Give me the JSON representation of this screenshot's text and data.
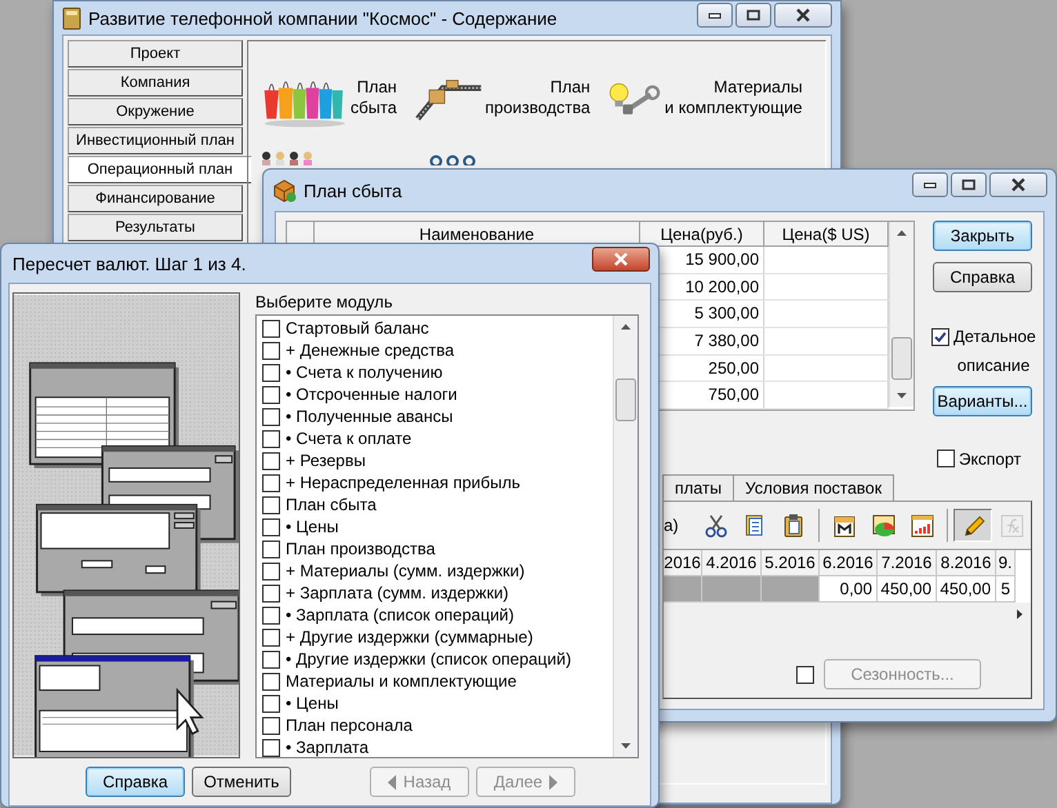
{
  "main_window": {
    "title": "Развитие телефонной компании \"Космос\" - Содержание",
    "nav": [
      {
        "label": "Проект",
        "selected": false
      },
      {
        "label": "Компания",
        "selected": false
      },
      {
        "label": "Окружение",
        "selected": false
      },
      {
        "label": "Инвестиционный план",
        "selected": false
      },
      {
        "label": "Операционный план",
        "selected": true
      },
      {
        "label": "Финансирование",
        "selected": false
      },
      {
        "label": "Результаты",
        "selected": false
      }
    ],
    "modules": [
      {
        "kind": "bags",
        "lines": [
          "План",
          "сбыта"
        ]
      },
      {
        "kind": "conveyor",
        "lines": [
          "План",
          "производства"
        ]
      },
      {
        "kind": "bulb",
        "lines": [
          "Материалы",
          "и комплектующие"
        ]
      },
      {
        "kind": "people"
      },
      {
        "kind": "gears"
      }
    ]
  },
  "sales_window": {
    "title": "План сбыта",
    "table": {
      "columns": [
        "Наименование",
        "Цена(руб.)",
        "Цена($ US)"
      ],
      "rows": [
        {
          "price_rub": "15 900,00"
        },
        {
          "price_rub": "10 200,00"
        },
        {
          "price_rub": "5 300,00"
        },
        {
          "price_rub": "7 380,00"
        },
        {
          "price_rub": "250,00"
        },
        {
          "price_rub": "750,00"
        }
      ]
    },
    "buttons": [
      {
        "label": "Закрыть",
        "highlighted": true
      },
      {
        "label": "Справка",
        "highlighted": false
      }
    ],
    "detailed": {
      "label": "Детальное описание",
      "checked": true
    },
    "variants_button": {
      "label": "Варианты...",
      "highlighted": true
    },
    "export": {
      "label": "Экспорт",
      "checked": false
    },
    "tabs": [
      {
        "label": "платы",
        "selected": false
      },
      {
        "label": "Условия поставок",
        "selected": false
      }
    ],
    "toolbar_caption": "а)",
    "toolbar": [
      {
        "kind": "cut",
        "pressed": false,
        "disabled": false
      },
      {
        "kind": "copy",
        "pressed": false,
        "disabled": false
      },
      {
        "kind": "paste",
        "pressed": false,
        "disabled": false
      },
      {
        "kind": "separator"
      },
      {
        "kind": "calendar",
        "pressed": false,
        "disabled": false
      },
      {
        "kind": "pie",
        "pressed": false,
        "disabled": false
      },
      {
        "kind": "chart",
        "pressed": false,
        "disabled": false
      },
      {
        "kind": "separator"
      },
      {
        "kind": "pencil",
        "pressed": true,
        "disabled": false
      },
      {
        "kind": "function",
        "pressed": false,
        "disabled": true
      }
    ],
    "periods": {
      "columns": [
        "2016",
        "4.2016",
        "5.2016",
        "6.2016",
        "7.2016",
        "8.2016",
        "9."
      ],
      "cells": [
        {
          "disabled": true
        },
        {
          "disabled": true
        },
        {
          "disabled": true
        },
        {
          "text": "0,00",
          "disabled": false
        },
        {
          "text": "450,00",
          "disabled": false
        },
        {
          "text": "450,00",
          "disabled": false
        },
        {
          "text": "5",
          "disabled": false
        }
      ]
    },
    "seasonality": {
      "label": "Сезонность...",
      "checked": false,
      "disabled": true
    }
  },
  "dialog": {
    "title": "Пересчет валют. Шаг 1 из 4.",
    "list_label": "Выберите модуль",
    "items": [
      {
        "label": "Стартовый баланс",
        "checked": false
      },
      {
        "label": "+ Денежные средства",
        "checked": false
      },
      {
        "label": "• Счета к получению",
        "checked": false
      },
      {
        "label": "• Отсроченные налоги",
        "checked": false
      },
      {
        "label": "• Полученные авансы",
        "checked": false
      },
      {
        "label": "• Счета к оплате",
        "checked": false
      },
      {
        "label": "+ Резервы",
        "checked": false
      },
      {
        "label": "+ Нераспределенная прибыль",
        "checked": false
      },
      {
        "label": "План сбыта",
        "checked": false
      },
      {
        "label": "• Цены",
        "checked": false
      },
      {
        "label": "План производства",
        "checked": false
      },
      {
        "label": "+ Материалы (сумм. издержки)",
        "checked": false
      },
      {
        "label": "+ Зарплата (сумм. издержки)",
        "checked": false
      },
      {
        "label": "• Зарплата (список операций)",
        "checked": false
      },
      {
        "label": "+ Другие издержки (суммарные)",
        "checked": false
      },
      {
        "label": "• Другие издержки (список операций)",
        "checked": false
      },
      {
        "label": "Материалы и комплектующие",
        "checked": false
      },
      {
        "label": "• Цены",
        "checked": false
      },
      {
        "label": "План персонала",
        "checked": false
      },
      {
        "label": "• Зарплата",
        "checked": false
      }
    ],
    "buttons": [
      {
        "label": "Справка",
        "highlighted": true,
        "disabled": false,
        "kind": "plain"
      },
      {
        "label": "Отменить",
        "highlighted": false,
        "disabled": false,
        "kind": "plain"
      },
      {
        "label": "Назад",
        "highlighted": false,
        "disabled": true,
        "kind": "back"
      },
      {
        "label": "Далее",
        "highlighted": false,
        "disabled": true,
        "kind": "next"
      }
    ]
  }
}
